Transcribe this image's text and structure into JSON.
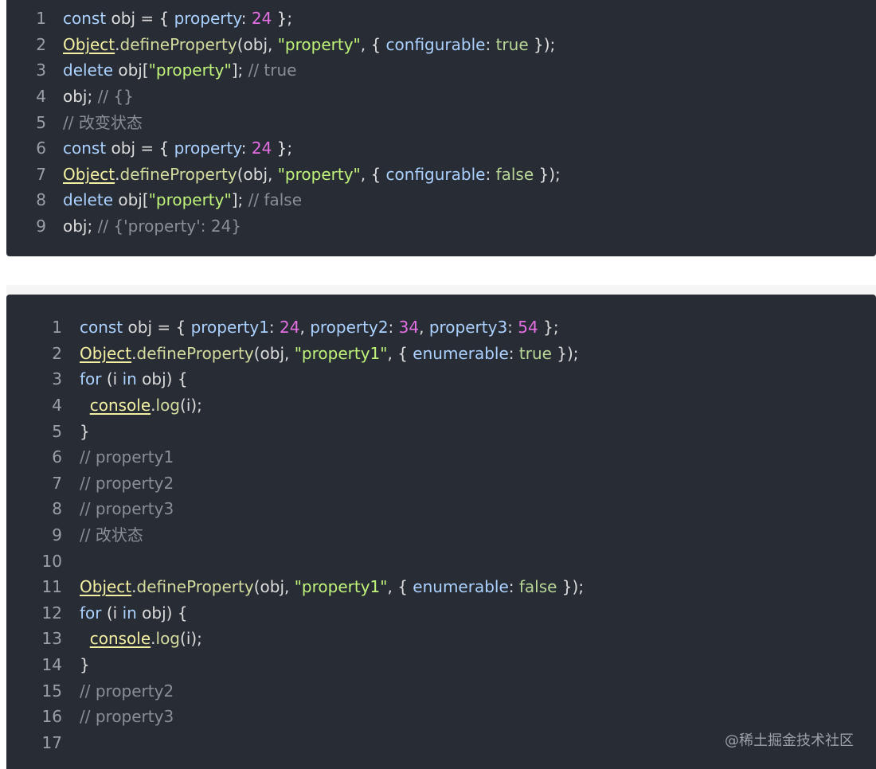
{
  "blocks": [
    {
      "lines": [
        {
          "number": "1",
          "tokens": [
            {
              "t": "const",
              "c": "k"
            },
            {
              "t": " obj = { ",
              "c": "p"
            },
            {
              "t": "property",
              "c": "k"
            },
            {
              "t": ": ",
              "c": "p"
            },
            {
              "t": "24",
              "c": "n"
            },
            {
              "t": " };",
              "c": "p"
            }
          ]
        },
        {
          "number": "2",
          "tokens": [
            {
              "t": "Object",
              "c": "o"
            },
            {
              "t": ".",
              "c": "p"
            },
            {
              "t": "defineProperty",
              "c": "f"
            },
            {
              "t": "(obj, ",
              "c": "p"
            },
            {
              "t": "\"property\"",
              "c": "s"
            },
            {
              "t": ", { ",
              "c": "p"
            },
            {
              "t": "configurable",
              "c": "k"
            },
            {
              "t": ": ",
              "c": "p"
            },
            {
              "t": "true",
              "c": "b"
            },
            {
              "t": " });",
              "c": "p"
            }
          ]
        },
        {
          "number": "3",
          "tokens": [
            {
              "t": "delete",
              "c": "k"
            },
            {
              "t": " obj[",
              "c": "p"
            },
            {
              "t": "\"property\"",
              "c": "s"
            },
            {
              "t": "]; ",
              "c": "p"
            },
            {
              "t": "// true",
              "c": "c"
            }
          ]
        },
        {
          "number": "4",
          "tokens": [
            {
              "t": "obj; ",
              "c": "p"
            },
            {
              "t": "// {}",
              "c": "c"
            }
          ]
        },
        {
          "number": "5",
          "tokens": [
            {
              "t": "// 改变状态",
              "c": "c"
            }
          ]
        },
        {
          "number": "6",
          "tokens": [
            {
              "t": "const",
              "c": "k"
            },
            {
              "t": " obj = { ",
              "c": "p"
            },
            {
              "t": "property",
              "c": "k"
            },
            {
              "t": ": ",
              "c": "p"
            },
            {
              "t": "24",
              "c": "n"
            },
            {
              "t": " };",
              "c": "p"
            }
          ]
        },
        {
          "number": "7",
          "tokens": [
            {
              "t": "Object",
              "c": "o"
            },
            {
              "t": ".",
              "c": "p"
            },
            {
              "t": "defineProperty",
              "c": "f"
            },
            {
              "t": "(obj, ",
              "c": "p"
            },
            {
              "t": "\"property\"",
              "c": "s"
            },
            {
              "t": ", { ",
              "c": "p"
            },
            {
              "t": "configurable",
              "c": "k"
            },
            {
              "t": ": ",
              "c": "p"
            },
            {
              "t": "false",
              "c": "b"
            },
            {
              "t": " });",
              "c": "p"
            }
          ]
        },
        {
          "number": "8",
          "tokens": [
            {
              "t": "delete",
              "c": "k"
            },
            {
              "t": " obj[",
              "c": "p"
            },
            {
              "t": "\"property\"",
              "c": "s"
            },
            {
              "t": "]; ",
              "c": "p"
            },
            {
              "t": "// false",
              "c": "c"
            }
          ]
        },
        {
          "number": "9",
          "tokens": [
            {
              "t": "obj; ",
              "c": "p"
            },
            {
              "t": "// {'property': 24}",
              "c": "c"
            }
          ]
        }
      ]
    },
    {
      "lines": [
        {
          "number": "1",
          "tokens": [
            {
              "t": "const",
              "c": "k"
            },
            {
              "t": " obj = { ",
              "c": "p"
            },
            {
              "t": "property1",
              "c": "k"
            },
            {
              "t": ": ",
              "c": "p"
            },
            {
              "t": "24",
              "c": "n"
            },
            {
              "t": ", ",
              "c": "p"
            },
            {
              "t": "property2",
              "c": "k"
            },
            {
              "t": ": ",
              "c": "p"
            },
            {
              "t": "34",
              "c": "n"
            },
            {
              "t": ", ",
              "c": "p"
            },
            {
              "t": "property3",
              "c": "k"
            },
            {
              "t": ": ",
              "c": "p"
            },
            {
              "t": "54",
              "c": "n"
            },
            {
              "t": " };",
              "c": "p"
            }
          ]
        },
        {
          "number": "2",
          "tokens": [
            {
              "t": "Object",
              "c": "o"
            },
            {
              "t": ".",
              "c": "p"
            },
            {
              "t": "defineProperty",
              "c": "f"
            },
            {
              "t": "(obj, ",
              "c": "p"
            },
            {
              "t": "\"property1\"",
              "c": "s"
            },
            {
              "t": ", { ",
              "c": "p"
            },
            {
              "t": "enumerable",
              "c": "k"
            },
            {
              "t": ": ",
              "c": "p"
            },
            {
              "t": "true",
              "c": "b"
            },
            {
              "t": " });",
              "c": "p"
            }
          ]
        },
        {
          "number": "3",
          "tokens": [
            {
              "t": "for",
              "c": "k"
            },
            {
              "t": " (i ",
              "c": "p"
            },
            {
              "t": "in",
              "c": "k"
            },
            {
              "t": " obj) {",
              "c": "p"
            }
          ]
        },
        {
          "number": "4",
          "tokens": [
            {
              "t": "  ",
              "c": "p"
            },
            {
              "t": "console",
              "c": "o"
            },
            {
              "t": ".",
              "c": "p"
            },
            {
              "t": "log",
              "c": "f"
            },
            {
              "t": "(i);",
              "c": "p"
            }
          ]
        },
        {
          "number": "5",
          "tokens": [
            {
              "t": "}",
              "c": "p"
            }
          ]
        },
        {
          "number": "6",
          "tokens": [
            {
              "t": "// property1",
              "c": "c"
            }
          ]
        },
        {
          "number": "7",
          "tokens": [
            {
              "t": "// property2",
              "c": "c"
            }
          ]
        },
        {
          "number": "8",
          "tokens": [
            {
              "t": "// property3",
              "c": "c"
            }
          ]
        },
        {
          "number": "9",
          "tokens": [
            {
              "t": "// 改状态",
              "c": "c"
            }
          ]
        },
        {
          "number": "10",
          "tokens": []
        },
        {
          "number": "11",
          "tokens": [
            {
              "t": "Object",
              "c": "o"
            },
            {
              "t": ".",
              "c": "p"
            },
            {
              "t": "defineProperty",
              "c": "f"
            },
            {
              "t": "(obj, ",
              "c": "p"
            },
            {
              "t": "\"property1\"",
              "c": "s"
            },
            {
              "t": ", { ",
              "c": "p"
            },
            {
              "t": "enumerable",
              "c": "k"
            },
            {
              "t": ": ",
              "c": "p"
            },
            {
              "t": "false",
              "c": "b"
            },
            {
              "t": " });",
              "c": "p"
            }
          ]
        },
        {
          "number": "12",
          "tokens": [
            {
              "t": "for",
              "c": "k"
            },
            {
              "t": " (i ",
              "c": "p"
            },
            {
              "t": "in",
              "c": "k"
            },
            {
              "t": " obj) {",
              "c": "p"
            }
          ]
        },
        {
          "number": "13",
          "tokens": [
            {
              "t": "  ",
              "c": "p"
            },
            {
              "t": "console",
              "c": "o"
            },
            {
              "t": ".",
              "c": "p"
            },
            {
              "t": "log",
              "c": "f"
            },
            {
              "t": "(i);",
              "c": "p"
            }
          ]
        },
        {
          "number": "14",
          "tokens": [
            {
              "t": "}",
              "c": "p"
            }
          ]
        },
        {
          "number": "15",
          "tokens": [
            {
              "t": "// property2",
              "c": "c"
            }
          ]
        },
        {
          "number": "16",
          "tokens": [
            {
              "t": "// property3",
              "c": "c"
            }
          ]
        },
        {
          "number": "17",
          "tokens": []
        }
      ]
    }
  ],
  "watermark": "@稀土掘金技术社区",
  "colors": {
    "background": "#282c34",
    "keyword": "#abd1ff",
    "number": "#e36fe3",
    "string": "#bff37a",
    "comment": "#8a8f96",
    "boolean": "#b9d796",
    "function": "#d3dc9e",
    "object": "#f4f0a3",
    "punctuation": "#dcdcdc",
    "line_number": "#9aa0a6"
  }
}
